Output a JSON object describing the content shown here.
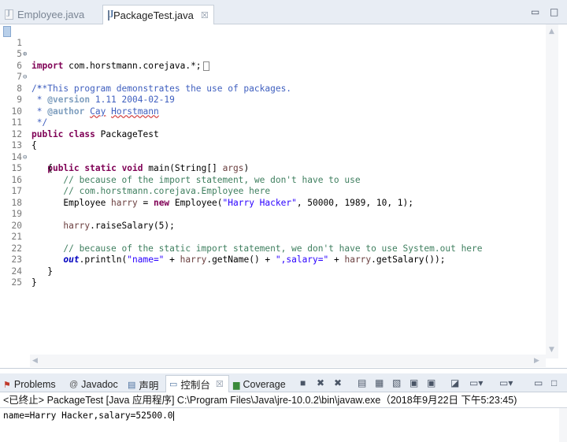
{
  "editor_tabs": {
    "inactive_tab": "Employee.java",
    "active_tab": "PackageTest.java",
    "close_glyph": "☒",
    "minimize_glyph": "▭",
    "maximize_glyph": "□"
  },
  "code_lines": [
    {
      "num": "1",
      "fold": "⊕"
    },
    {
      "num": "5",
      "fold": ""
    },
    {
      "num": "6",
      "fold": "⊖"
    },
    {
      "num": "7",
      "fold": ""
    },
    {
      "num": "8",
      "fold": ""
    },
    {
      "num": "9",
      "fold": ""
    },
    {
      "num": "10",
      "fold": ""
    },
    {
      "num": "11",
      "fold": ""
    },
    {
      "num": "12",
      "fold": ""
    },
    {
      "num": "13",
      "fold": "⊖"
    },
    {
      "num": "14",
      "fold": ""
    },
    {
      "num": "15",
      "fold": ""
    },
    {
      "num": "16",
      "fold": ""
    },
    {
      "num": "17",
      "fold": ""
    },
    {
      "num": "18",
      "fold": ""
    },
    {
      "num": "19",
      "fold": ""
    },
    {
      "num": "20",
      "fold": ""
    },
    {
      "num": "21",
      "fold": ""
    },
    {
      "num": "22",
      "fold": ""
    },
    {
      "num": "23",
      "fold": ""
    },
    {
      "num": "24",
      "fold": ""
    },
    {
      "num": "25",
      "fold": ""
    }
  ],
  "code": {
    "l1": {
      "kw": "import",
      "rest": " com.horstmann.corejava.*;"
    },
    "l6": "/**",
    "l7": " * This program demonstrates the use of packages.",
    "l8": {
      "pre": " * ",
      "tag": "@version",
      "rest": " 1.11 2004-02-19"
    },
    "l9": {
      "pre": " * ",
      "tag": "@author",
      "sp": " ",
      "name1": "Cay",
      "sp2": " ",
      "name2": "Horstmann"
    },
    "l10": " */",
    "l11": {
      "kw1": "public",
      "sp": " ",
      "kw2": "class",
      "rest": " PackageTest"
    },
    "l12": "{",
    "l13": {
      "indent": "   ",
      "kw1": "public",
      "sp1": " ",
      "kw2": "static",
      "sp2": " ",
      "kw3": "void",
      "rest": " main(String[] ",
      "param": "args",
      "end": ")"
    },
    "l14": "   {",
    "l15": "      // because of the import statement, we don't have to use",
    "l16": "      // com.horstmann.corejava.Employee here",
    "l17": {
      "indent": "      ",
      "pre": "Employee ",
      "var": "harry",
      "mid": " = ",
      "kw": "new",
      "mid2": " Employee(",
      "str": "\"Harry Hacker\"",
      "end": ", 50000, 1989, 10, 1);"
    },
    "l19": {
      "indent": "      ",
      "var": "harry",
      "rest": ".raiseSalary(5);"
    },
    "l21": "      // because of the static import statement, we don't have to use System.out here",
    "l22": {
      "indent": "      ",
      "fld": "out",
      "a": ".println(",
      "s1": "\"name=\"",
      "b": " + ",
      "v1": "harry",
      "c": ".getName() + ",
      "s2": "\",salary=\"",
      "d": " + ",
      "v2": "harry",
      "e": ".getSalary());"
    },
    "l23": "   }",
    "l24": "}"
  },
  "view_tabs": {
    "problems": "Problems",
    "javadoc": "Javadoc",
    "declaration": "声明",
    "console": "控制台",
    "close_glyph": "☒",
    "coverage": "Coverage"
  },
  "console": {
    "header": "<已终止> PackageTest [Java 应用程序] C:\\Program Files\\Java\\jre-10.0.2\\bin\\javaw.exe（2018年9月22日 下午5:23:45)",
    "output": "name=Harry Hacker,salary=52500.0"
  }
}
